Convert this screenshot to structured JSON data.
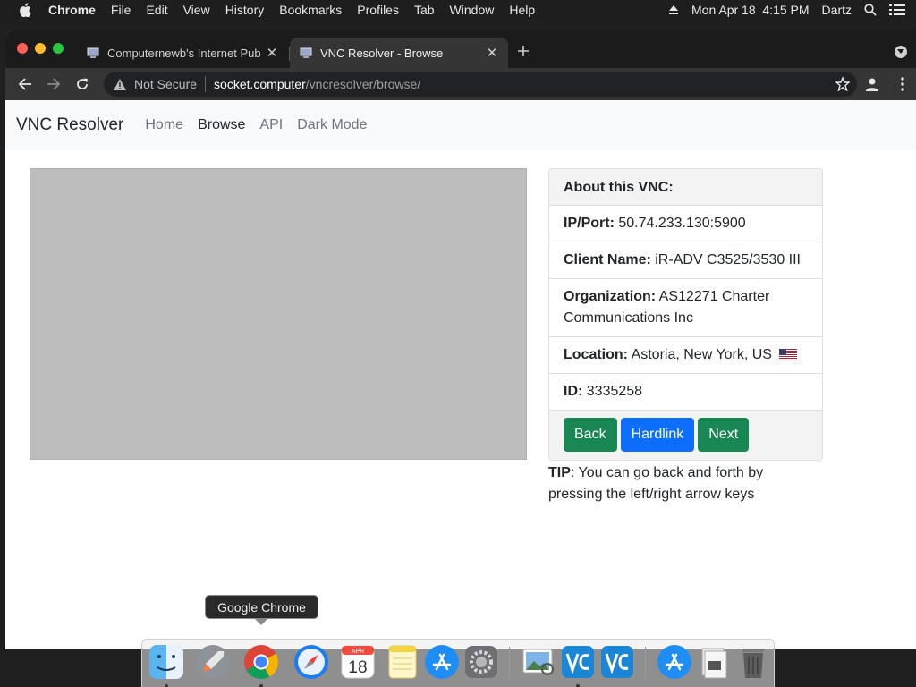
{
  "menubar": {
    "app": "Chrome",
    "menus": [
      "File",
      "Edit",
      "View",
      "History",
      "Bookmarks",
      "Profiles",
      "Tab",
      "Window",
      "Help"
    ],
    "clock": "Mon Apr 18  4:15 PM",
    "user": "Dartz"
  },
  "tabs": [
    {
      "title": "Computernewb's Internet Pub",
      "active": false
    },
    {
      "title": "VNC Resolver - Browse",
      "active": true
    }
  ],
  "omnibox": {
    "security": "Not Secure",
    "host": "socket.computer",
    "path": "/vncresolver/browse/"
  },
  "site": {
    "brand": "VNC Resolver",
    "nav": [
      {
        "label": "Home",
        "active": false
      },
      {
        "label": "Browse",
        "active": true
      },
      {
        "label": "API",
        "active": false
      },
      {
        "label": "Dark Mode",
        "active": false
      }
    ]
  },
  "vnc": {
    "header": "About this VNC:",
    "ip_key": "IP/Port:",
    "ip_value": "50.74.233.130:5900",
    "client_key": "Client Name:",
    "client_value": "iR-ADV C3525/3530 III",
    "org_key": "Organization:",
    "org_value": "AS12271 Charter Communications Inc",
    "loc_key": "Location:",
    "loc_value": "Astoria, New York, US",
    "id_key": "ID:",
    "id_value": "3335258",
    "buttons": {
      "back": "Back",
      "hardlink": "Hardlink",
      "next": "Next"
    }
  },
  "tip": {
    "key": "TIP",
    "text": ": You can go back and forth by pressing the left/right arrow keys"
  },
  "dock": {
    "tooltip": "Google Chrome",
    "icon_calendar_month": "APR",
    "icon_calendar_day": "18"
  },
  "colors": {
    "green_button": "#198754",
    "blue_button": "#0d6efd",
    "navbar_bg": "#f8f9fa",
    "chrome_toolbar": "#353535"
  }
}
